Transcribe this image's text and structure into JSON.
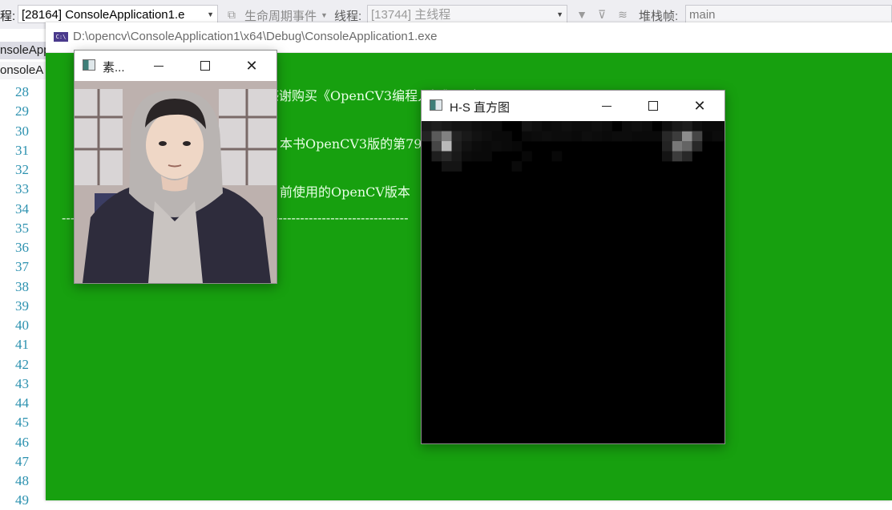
{
  "toolbar": {
    "process_label": "程:",
    "process_value": "[28164] ConsoleApplication1.e",
    "lifecycle_label": "生命周期事件",
    "thread_label": "线程:",
    "thread_value": "[13744] 主线程",
    "stack_label": "堆栈帧:",
    "stack_value": "main"
  },
  "editor": {
    "tabs": [
      "nsoleApp",
      "onsoleA"
    ],
    "line_numbers": [
      "28",
      "29",
      "30",
      "31",
      "32",
      "33",
      "34",
      "35",
      "36",
      "37",
      "38",
      "39",
      "40",
      "41",
      "42",
      "43",
      "44",
      "45",
      "46",
      "47",
      "48",
      "49"
    ]
  },
  "console": {
    "title": "D:\\opencv\\ConsoleApplication1\\x64\\Debug\\ConsoleApplication1.exe",
    "lines": [
      "感谢购买《OpenCV3编程入门》一书!",
      "本书OpenCV3版的第79",
      "前使用的OpenCV版本",
      "--------------------------------------------------------------------------------"
    ]
  },
  "source_window": {
    "title": "素..."
  },
  "hist_window": {
    "title": "H-S 直方图",
    "cells": [
      [
        0,
        0,
        25
      ],
      [
        0,
        1,
        35
      ],
      [
        1,
        0,
        30
      ],
      [
        1,
        1,
        90
      ],
      [
        1,
        2,
        70
      ],
      [
        1,
        3,
        30
      ],
      [
        2,
        0,
        25
      ],
      [
        2,
        1,
        130
      ],
      [
        2,
        2,
        185
      ],
      [
        2,
        3,
        40
      ],
      [
        2,
        4,
        20
      ],
      [
        3,
        0,
        20
      ],
      [
        3,
        1,
        35
      ],
      [
        3,
        2,
        30
      ],
      [
        3,
        3,
        25
      ],
      [
        3,
        4,
        20
      ],
      [
        4,
        0,
        20
      ],
      [
        4,
        1,
        25
      ],
      [
        4,
        2,
        18
      ],
      [
        5,
        0,
        15
      ],
      [
        5,
        1,
        18
      ],
      [
        6,
        0,
        12
      ],
      [
        6,
        1,
        14
      ],
      [
        7,
        0,
        12
      ],
      [
        7,
        1,
        10
      ],
      [
        8,
        1,
        10
      ],
      [
        9,
        2,
        8
      ],
      [
        10,
        1,
        10
      ],
      [
        11,
        1,
        12
      ],
      [
        12,
        0,
        10
      ],
      [
        13,
        1,
        12
      ],
      [
        14,
        1,
        12
      ],
      [
        15,
        1,
        10
      ],
      [
        16,
        1,
        14
      ],
      [
        17,
        1,
        12
      ],
      [
        18,
        1,
        10
      ],
      [
        19,
        1,
        12
      ],
      [
        20,
        1,
        12
      ],
      [
        21,
        1,
        10
      ],
      [
        22,
        1,
        10
      ],
      [
        23,
        1,
        10
      ],
      [
        24,
        1,
        12
      ],
      [
        25,
        1,
        10
      ],
      [
        26,
        1,
        12
      ],
      [
        27,
        1,
        10
      ],
      [
        28,
        1,
        8
      ],
      [
        29,
        0,
        10
      ],
      [
        29,
        1,
        12
      ],
      [
        30,
        1,
        12
      ],
      [
        31,
        0,
        12
      ],
      [
        31,
        1,
        10
      ],
      [
        32,
        1,
        12
      ],
      [
        33,
        1,
        15
      ],
      [
        34,
        1,
        10
      ],
      [
        35,
        1,
        12
      ],
      [
        36,
        0,
        10
      ],
      [
        36,
        1,
        12
      ],
      [
        37,
        0,
        20
      ],
      [
        37,
        1,
        15
      ],
      [
        38,
        0,
        12
      ],
      [
        38,
        1,
        15
      ],
      [
        39,
        1,
        10
      ],
      [
        4,
        3,
        12
      ],
      [
        5,
        3,
        10
      ],
      [
        9,
        4,
        10
      ],
      [
        10,
        3,
        8
      ],
      [
        13,
        3,
        8
      ],
      [
        6,
        2,
        10
      ],
      [
        7,
        2,
        12
      ],
      [
        8,
        2,
        10
      ],
      [
        5,
        2,
        12
      ],
      [
        6,
        3,
        10
      ],
      [
        10,
        0,
        20
      ],
      [
        11,
        0,
        15
      ],
      [
        12,
        1,
        14
      ],
      [
        13,
        0,
        12
      ],
      [
        14,
        0,
        15
      ],
      [
        15,
        0,
        12
      ],
      [
        16,
        0,
        12
      ],
      [
        17,
        0,
        15
      ],
      [
        18,
        0,
        12
      ],
      [
        20,
        0,
        12
      ],
      [
        21,
        0,
        15
      ],
      [
        22,
        0,
        12
      ],
      [
        24,
        0,
        14
      ],
      [
        25,
        0,
        12
      ],
      [
        26,
        0,
        12
      ],
      [
        27,
        0,
        15
      ],
      [
        28,
        0,
        10
      ],
      [
        30,
        0,
        12
      ],
      [
        32,
        0,
        12
      ],
      [
        33,
        0,
        12
      ],
      [
        34,
        0,
        12
      ],
      [
        35,
        0,
        12
      ],
      [
        25,
        1,
        60
      ],
      [
        25,
        2,
        120
      ],
      [
        26,
        1,
        140
      ],
      [
        26,
        2,
        100
      ],
      [
        25,
        3,
        60
      ],
      [
        26,
        3,
        40
      ],
      [
        24,
        2,
        35
      ],
      [
        24,
        1,
        40
      ],
      [
        27,
        1,
        70
      ],
      [
        27,
        2,
        40
      ],
      [
        24,
        3,
        20
      ],
      [
        26,
        0,
        30
      ],
      [
        25,
        0,
        25
      ]
    ]
  }
}
